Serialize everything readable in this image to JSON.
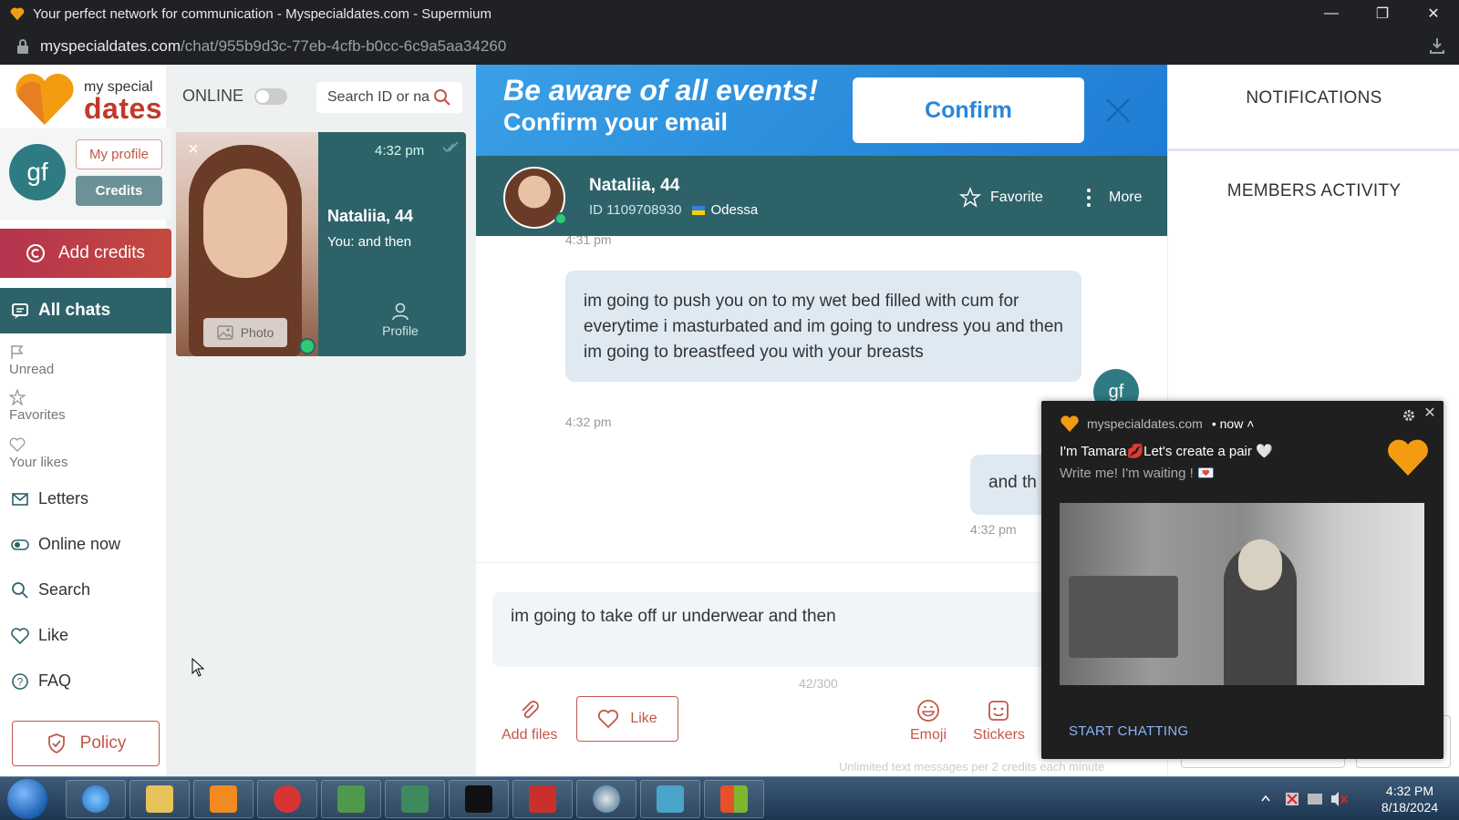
{
  "browser": {
    "title": "Your perfect network for communication - Myspecialdates.com - Supermium",
    "url_host": "myspecialdates.com",
    "url_path": "/chat/955b9d3c-77eb-4cfb-b0cc-6c9a5aa34260",
    "window_buttons": [
      "minimize-icon",
      "restore-icon",
      "close-icon"
    ]
  },
  "logo": {
    "line1": "my special",
    "line2": "dates"
  },
  "user": {
    "initials": "gf",
    "my_profile": "My profile",
    "credits": "Credits"
  },
  "sidebar": {
    "add_credits": "Add credits",
    "all_chats": "All chats",
    "filters": [
      {
        "label": "Unread",
        "icon": "flag-icon"
      },
      {
        "label": "Favorites",
        "icon": "star-icon"
      },
      {
        "label": "Your likes",
        "icon": "heart-icon"
      }
    ],
    "items": [
      {
        "label": "Letters",
        "icon": "envelope-icon"
      },
      {
        "label": "Online now",
        "icon": "toggle-icon"
      },
      {
        "label": "Search",
        "icon": "search-icon"
      },
      {
        "label": "Like",
        "icon": "heart-check-icon"
      },
      {
        "label": "FAQ",
        "icon": "question-icon"
      }
    ],
    "policy": "Policy"
  },
  "chatlist": {
    "online_label": "ONLINE",
    "search_placeholder": "Search ID or name",
    "card": {
      "time": "4:32 pm",
      "name": "Nataliia, 44",
      "last_message": "You:  and then",
      "photo_label": "Photo",
      "profile_label": "Profile"
    }
  },
  "banner": {
    "line1": "Be aware of all events!",
    "line2": "Confirm your email",
    "confirm": "Confirm"
  },
  "chat_header": {
    "name": "Nataliia, 44",
    "id": "ID 1109708930",
    "city": "Odessa",
    "favorite": "Favorite",
    "more": "More"
  },
  "messages": {
    "prev_time": "4:31 pm",
    "m1_text": "im going to push you on to my wet bed filled with cum for everytime i masturbated and im going to undress you and then im going to breastfeed you with your breasts",
    "m1_time": "4:32 pm",
    "m1_avatar": "gf",
    "m2_text": "and th",
    "m2_time": "4:32 pm"
  },
  "composer": {
    "text": "im going to take off ur underwear and then",
    "counter": "42/300",
    "add_files": "Add files",
    "like": "Like",
    "emoji": "Emoji",
    "stickers": "Stickers",
    "footnote": "Unlimited text messages per 2 credits each minute"
  },
  "right_panel": {
    "notifications": "NOTIFICATIONS",
    "members_activity": "MEMBERS ACTIVITY"
  },
  "notification": {
    "source": "myspecialdates.com",
    "when": "• now ˄",
    "title": "I'm Tamara💋Let's create a pair 🤍",
    "body": "Write me! I'm waiting ! 💌",
    "cta": "START CHATTING"
  },
  "taskbar": {
    "time": "4:32 PM",
    "date": "8/18/2024",
    "apps": [
      "internet-explorer-icon",
      "file-explorer-icon",
      "media-player-icon",
      "d-app-icon",
      "window-app-icon",
      "monitor-app-icon",
      "terminal-icon",
      "toolbox-icon",
      "browser-globe-icon",
      "cubes-app-icon",
      "windows-flag-icon"
    ]
  },
  "colors": {
    "teal": "#2e6269",
    "accent": "#c2574a",
    "banner": "#2a86d8"
  }
}
